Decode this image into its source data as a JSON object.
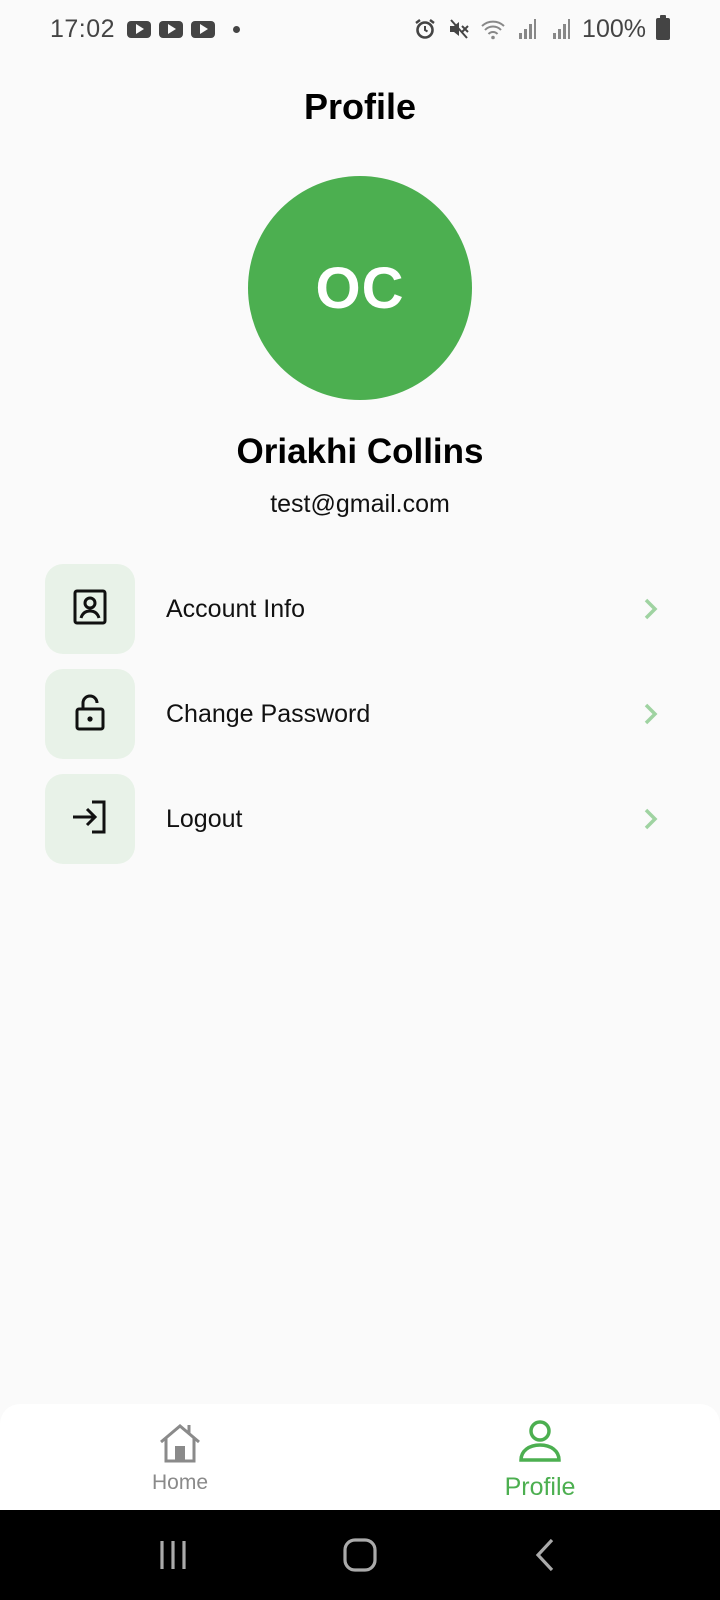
{
  "status_bar": {
    "time": "17:02",
    "notification_icons": [
      "youtube-icon",
      "youtube-icon",
      "youtube-icon"
    ],
    "system_icons": [
      "alarm-icon",
      "mute-icon",
      "wifi-icon",
      "signal-icon",
      "signal-icon"
    ],
    "battery": "100%"
  },
  "header": {
    "title": "Profile"
  },
  "profile": {
    "initials": "OC",
    "avatar_color": "#4caf50",
    "name": "Oriakhi Collins",
    "email": "test@gmail.com"
  },
  "menu": {
    "items": [
      {
        "label": "Account Info",
        "icon": "account-info-icon"
      },
      {
        "label": "Change Password",
        "icon": "lock-icon"
      },
      {
        "label": "Logout",
        "icon": "logout-icon"
      }
    ],
    "icon_bg_color": "#e8f2e8",
    "chevron_color": "#9fd3a1"
  },
  "bottom_nav": {
    "items": [
      {
        "label": "Home",
        "icon": "home-icon",
        "active": false
      },
      {
        "label": "Profile",
        "icon": "profile-icon",
        "active": true
      }
    ],
    "active_color": "#4caf50",
    "inactive_color": "#8a8a8a"
  },
  "system_nav": {
    "buttons": [
      "recents-icon",
      "home-circle-icon",
      "back-icon"
    ]
  }
}
